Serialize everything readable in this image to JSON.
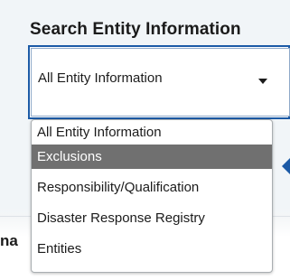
{
  "form": {
    "title": "Search Entity Information",
    "select": {
      "selected_value": "All Entity Information"
    }
  },
  "dropdown": {
    "options": [
      {
        "label": "All Entity Information",
        "highlighted": false
      },
      {
        "label": "Exclusions",
        "highlighted": true
      },
      {
        "label": "Responsibility/Qualification",
        "highlighted": false
      },
      {
        "label": "Disaster Response Registry",
        "highlighted": false
      },
      {
        "label": "Entities",
        "highlighted": false
      }
    ]
  },
  "background": {
    "partial_heading": "na"
  },
  "icons": {
    "caret": "chevron-down-icon",
    "pointer": "arrow-left-icon"
  },
  "colors": {
    "accent": "#1b5aa6",
    "highlight": "#707070",
    "text": "#1b1b1b"
  }
}
